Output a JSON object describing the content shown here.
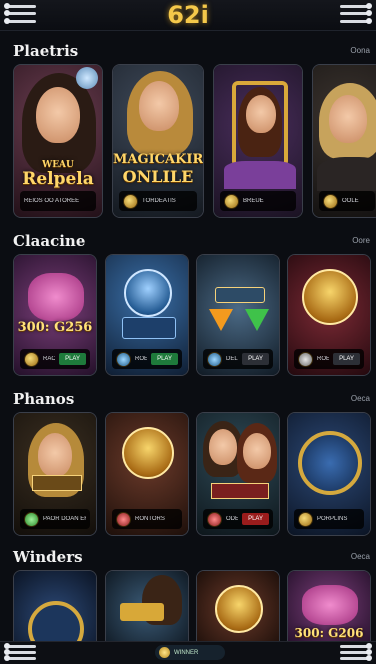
{
  "header": {
    "logo": "62i"
  },
  "sections": [
    {
      "title": "Plaetris",
      "more": "Oona",
      "cards": [
        {
          "title_art": "Relpela",
          "title_top": "WEAU",
          "bar": "REIOS OO ATOREE",
          "play": ""
        },
        {
          "title_art": "MAGICAKIR",
          "title_top": "",
          "title_sub": "ONLILE",
          "bar": "TORDEATIS",
          "play": ""
        },
        {
          "title_art": "",
          "bar": "BREUE",
          "play": ""
        },
        {
          "title_art": "",
          "bar": "OOLE",
          "play": ""
        }
      ]
    },
    {
      "title": "Claacine",
      "more": "Oore",
      "cards": [
        {
          "title_art": "300: G256",
          "bar": "RAOE",
          "play": "PLAY"
        },
        {
          "title_art": "",
          "bar": "ROE",
          "play": "PLAY"
        },
        {
          "title_art": "",
          "bar": "DELIOR ROINS",
          "play": "PLAY"
        },
        {
          "title_art": "",
          "bar": "ROE",
          "play": "PLAY"
        }
      ]
    },
    {
      "title": "Phanos",
      "more": "Oeca",
      "cards": [
        {
          "title_art": "",
          "bar": "PAOR DOAN ER",
          "play": ""
        },
        {
          "title_art": "",
          "bar": "RONTORS",
          "play": ""
        },
        {
          "title_art": "",
          "bar": "ODE",
          "play": "PLAY"
        },
        {
          "title_art": "",
          "bar": "PORPLINS",
          "play": ""
        }
      ]
    },
    {
      "title": "Winders",
      "more": "Oeca",
      "cards": [
        {
          "title_art": ""
        },
        {
          "title_art": ""
        },
        {
          "title_art": ""
        },
        {
          "title_art": "300: G206"
        }
      ]
    }
  ],
  "bottom_nav": {
    "label": "WINNER"
  },
  "colors": {
    "accent_gold": "#f4c84a",
    "play_green": "#1e7a3b",
    "play_red": "#9a1c1c"
  }
}
